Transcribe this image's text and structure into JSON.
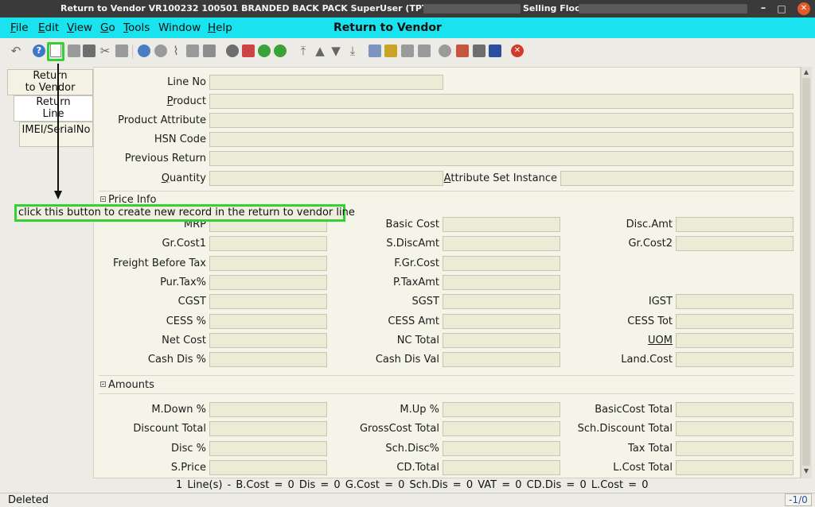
{
  "titlebar": {
    "text": "Return to Vendor  VR100232  100501  BRANDED BACK PACK  SuperUser (TPT Admin) @",
    "text2": "Selling Floor",
    "min_glyph": "–",
    "max_glyph": "□",
    "close_glyph": "✕"
  },
  "menubar": {
    "items": [
      {
        "label": "File"
      },
      {
        "label": "Edit"
      },
      {
        "label": "View"
      },
      {
        "label": "Go"
      },
      {
        "label": "Tools"
      },
      {
        "label": "Window"
      },
      {
        "label": "Help"
      }
    ],
    "window_title": "Return to Vendor"
  },
  "toolbar": {
    "help_glyph": "?",
    "close_glyph": "✕",
    "icons": [
      "undo-icon",
      "help-icon",
      "new-record-icon",
      "copy-record-icon",
      "delete-icon",
      "delete-selection-icon",
      "save-icon",
      "refresh-icon",
      "find-icon",
      "attachment-icon",
      "chat-icon",
      "history-icon",
      "home-icon",
      "parent-record-icon",
      "detail-record-icon",
      "first-record-icon",
      "previous-record-icon",
      "next-record-icon",
      "last-record-icon",
      "report-icon",
      "archive-icon",
      "print-icon",
      "print-preview-icon",
      "zoom-across-icon",
      "workflow-icon",
      "product-info-icon",
      "end-icon"
    ]
  },
  "tabs": [
    {
      "label_line1": "Return",
      "label_line2": "to Vendor"
    },
    {
      "label_line1": "Return",
      "label_line2": "Line"
    },
    {
      "label_line1": "IMEI/SerialNo",
      "label_line2": ""
    }
  ],
  "form": {
    "line_no": {
      "label": "Line No",
      "value": ""
    },
    "product": {
      "label_u": "P",
      "label_rest": "roduct",
      "value": ""
    },
    "product_attribute": {
      "label": "Product Attribute",
      "value": ""
    },
    "hsn_code": {
      "label": "HSN Code",
      "value": ""
    },
    "previous_return": {
      "label": "Previous Return",
      "value": ""
    },
    "quantity": {
      "label_u": "Q",
      "label_rest": "uantity",
      "value": ""
    },
    "attribute_set_instance": {
      "label_u": "A",
      "label_rest": "ttribute Set Instance",
      "value": ""
    }
  },
  "price_info": {
    "section_title": "Price Info",
    "rows": [
      [
        "MRP",
        "Basic Cost",
        "Disc.Amt"
      ],
      [
        "Gr.Cost1",
        "S.DiscAmt",
        "Gr.Cost2"
      ],
      [
        "Freight Before Tax",
        "F.Gr.Cost",
        ""
      ],
      [
        "Pur.Tax%",
        "P.TaxAmt",
        ""
      ],
      [
        "CGST",
        "SGST",
        "IGST"
      ],
      [
        "CESS %",
        "CESS Amt",
        "CESS Tot"
      ],
      [
        "Net Cost",
        "NC Total",
        "UOM"
      ],
      [
        "Cash Dis %",
        "Cash Dis Val",
        "Land.Cost"
      ]
    ]
  },
  "amounts": {
    "section_title": "Amounts",
    "rows": [
      [
        "M.Down %",
        "M.Up %",
        "BasicCost Total"
      ],
      [
        "Discount Total",
        "GrossCost Total",
        "Sch.Discount Total"
      ],
      [
        "Disc %",
        "Sch.Disc%",
        "Tax Total"
      ],
      [
        "S.Price",
        "CD.Total",
        "L.Cost Total"
      ]
    ]
  },
  "summary": "1 Line(s) -   B.Cost = 0    Dis = 0    G.Cost = 0    Sch.Dis = 0    VAT = 0    CD.Dis = 0    L.Cost = 0",
  "status": {
    "message": "Deleted",
    "record_indicator": "-1/0"
  },
  "annotation": {
    "text": "click this button to create new record in the return to vendor line"
  }
}
